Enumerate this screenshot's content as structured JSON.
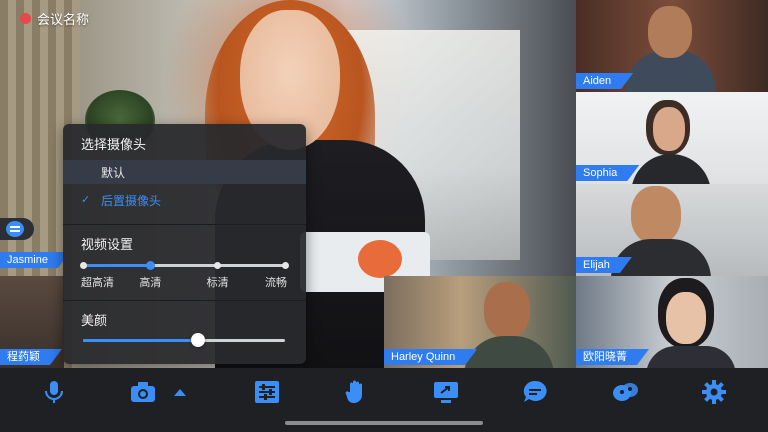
{
  "meeting": {
    "title": "会议名称",
    "recording_color": "#e5484d"
  },
  "accent_color": "#2f7cf0",
  "participants_side": [
    {
      "name": "Aiden"
    },
    {
      "name": "Sophia"
    },
    {
      "name": "Elijah"
    },
    {
      "name": "欧阳晓菁"
    }
  ],
  "participants_bottom": [
    {
      "name": "程药颖"
    },
    {
      "name": "Harley Quinn"
    }
  ],
  "left_edge_name": "Jasmine",
  "camera_panel": {
    "select_camera_title": "选择摄像头",
    "camera_options": [
      {
        "label": "默认",
        "selected": true
      },
      {
        "label": "后置摄像头",
        "active": true
      }
    ],
    "video_settings_title": "视频设置",
    "quality_levels": [
      "超高清",
      "高清",
      "标清",
      "流畅"
    ],
    "quality_selected": "高清",
    "beauty_title": "美颜",
    "beauty_level": 0.57
  },
  "toolbar": {
    "items": [
      {
        "icon": "microphone-icon"
      },
      {
        "icon": "camera-icon"
      },
      {
        "icon": "caret-up-icon"
      },
      {
        "icon": "settings-sliders-icon"
      },
      {
        "icon": "raise-hand-icon"
      },
      {
        "icon": "screen-share-icon"
      },
      {
        "icon": "chat-icon"
      },
      {
        "icon": "participants-icon"
      },
      {
        "icon": "gear-icon"
      }
    ]
  }
}
